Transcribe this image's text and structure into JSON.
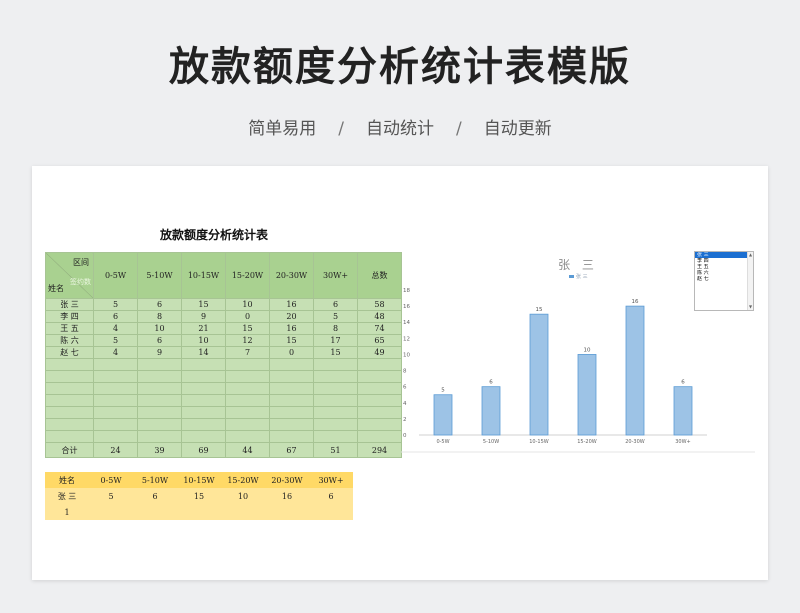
{
  "header": {
    "title": "放款额度分析统计表模版",
    "tags": [
      "简单易用",
      "自动统计",
      "自动更新"
    ]
  },
  "sheet_title": "放款额度分析统计表",
  "green_table": {
    "corner": {
      "top": "区间",
      "mid": "签约数",
      "bottom": "姓名"
    },
    "columns": [
      "0-5W",
      "5-10W",
      "10-15W",
      "15-20W",
      "20-30W",
      "30W+",
      "总数"
    ],
    "rows": [
      {
        "name": "张 三",
        "values": [
          "5",
          "6",
          "15",
          "10",
          "16",
          "6",
          "58"
        ]
      },
      {
        "name": "李 四",
        "values": [
          "6",
          "8",
          "9",
          "0",
          "20",
          "5",
          "48"
        ]
      },
      {
        "name": "王 五",
        "values": [
          "4",
          "10",
          "21",
          "15",
          "16",
          "8",
          "74"
        ]
      },
      {
        "name": "陈 六",
        "values": [
          "5",
          "6",
          "10",
          "12",
          "15",
          "17",
          "65"
        ]
      },
      {
        "name": "赵 七",
        "values": [
          "4",
          "9",
          "14",
          "7",
          "0",
          "15",
          "49"
        ]
      }
    ],
    "total": {
      "label": "合计",
      "values": [
        "24",
        "39",
        "69",
        "44",
        "67",
        "51",
        "294"
      ]
    }
  },
  "yellow_table": {
    "headers": [
      "姓名",
      "0-5W",
      "5-10W",
      "10-15W",
      "15-20W",
      "20-30W",
      "30W+"
    ],
    "row": [
      "张 三",
      "5",
      "6",
      "15",
      "10",
      "16",
      "6"
    ],
    "extra": "1"
  },
  "listbox": {
    "items": [
      "张 三",
      "李 四",
      "王 五",
      "陈 六",
      "赵 七"
    ],
    "selected": 0
  },
  "chart_data": {
    "type": "bar",
    "title": "张 三",
    "legend": "张 三",
    "categories": [
      "0-5W",
      "5-10W",
      "10-15W",
      "15-20W",
      "20-30W",
      "30W+"
    ],
    "series": [
      {
        "name": "张 三",
        "values": [
          5,
          6,
          15,
          10,
          16,
          6
        ]
      }
    ],
    "ylim": [
      0,
      18
    ],
    "yticks": [
      0,
      2,
      4,
      6,
      8,
      10,
      12,
      14,
      16,
      18
    ],
    "color": "#5b9bd5"
  }
}
